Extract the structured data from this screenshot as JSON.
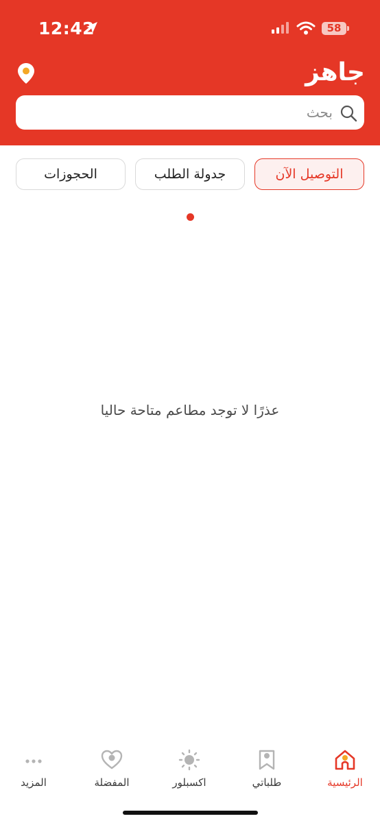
{
  "status_bar": {
    "time": "12:42",
    "battery": "58"
  },
  "header": {
    "logo": "جاهز",
    "brand_color": "#E53726"
  },
  "search": {
    "placeholder": "بحث",
    "value": ""
  },
  "tabs": [
    {
      "label": "التوصيل الآن",
      "active": true
    },
    {
      "label": "جدولة الطلب",
      "active": false
    },
    {
      "label": "الحجوزات",
      "active": false
    }
  ],
  "main": {
    "empty_message": "عذرًا لا توجد مطاعم متاحة حاليا"
  },
  "bottom_nav": {
    "items": [
      {
        "label": "الرئيسية",
        "icon": "home-icon",
        "active": true
      },
      {
        "label": "طلباتي",
        "icon": "bookmark-icon",
        "active": false
      },
      {
        "label": "اكسبلور",
        "icon": "explore-icon",
        "active": false
      },
      {
        "label": "المفضلة",
        "icon": "heart-icon",
        "active": false
      },
      {
        "label": "المزيد",
        "icon": "more-icon",
        "active": false
      }
    ]
  }
}
